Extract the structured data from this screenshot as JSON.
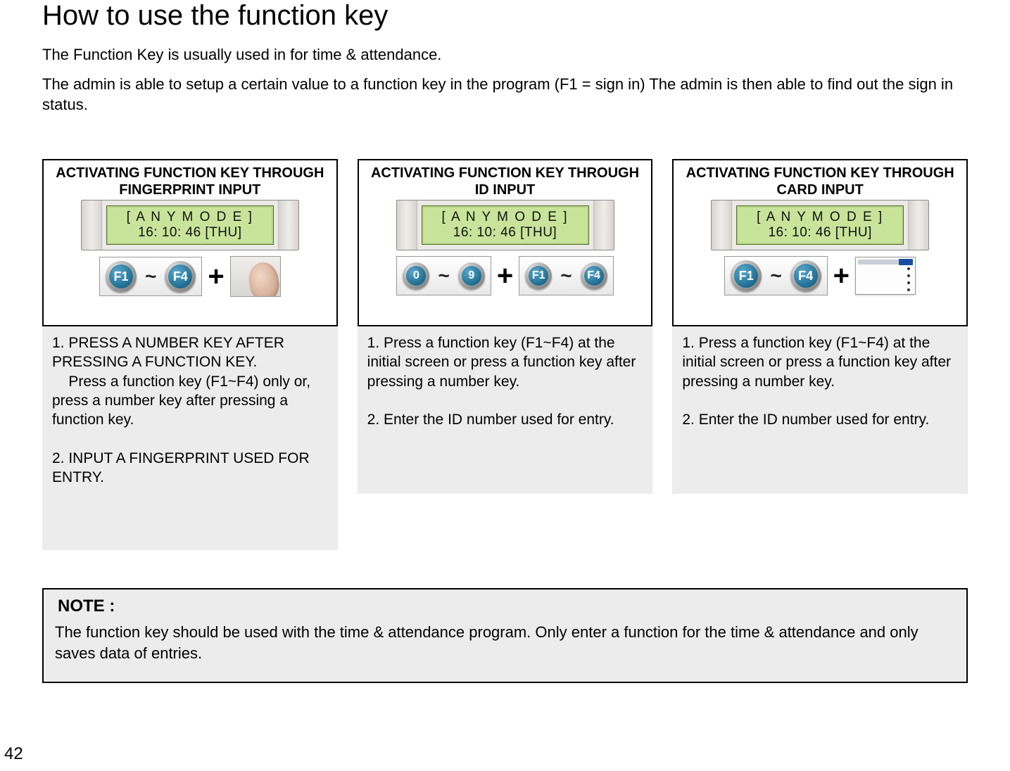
{
  "page_number": "42",
  "title": "How to use the function key",
  "intro1": "The Function Key is usually used in for time & attendance.",
  "intro2": "The admin is able to setup a certain value to a function key in the program (F1 = sign in) The admin is then able to find out the sign in status.",
  "lcd": {
    "line1": "[ A N Y  M O D E ]",
    "line2": "16: 10: 46 [THU]"
  },
  "keys": {
    "f1": "F1",
    "f4": "F4",
    "d0": "0",
    "d9": "9"
  },
  "tilde": "~",
  "plus": "+",
  "columns": [
    {
      "heading": "ACTIVATING FUNCTION KEY THROUGH FINGERPRINT INPUT",
      "steps": "1. PRESS A NUMBER KEY AFTER PRESSING A FUNCTION KEY.\n    Press a function key (F1~F4) only or, press a number key after pressing a function key.\n\n2. INPUT A FINGERPRINT USED FOR ENTRY."
    },
    {
      "heading": "ACTIVATING FUNCTION KEY THROUGH ID INPUT",
      "steps": "1. Press a function key (F1~F4) at the initial screen or press a function key after pressing a number key.\n\n2. Enter the ID number used for entry."
    },
    {
      "heading": "ACTIVATING FUNCTION KEY THROUGH CARD INPUT",
      "steps": "1. Press a function key (F1~F4) at the initial screen or press a function key after pressing a number key.\n\n2. Enter the ID number used for entry."
    }
  ],
  "note": {
    "label": "NOTE :",
    "text": "The function key should be used with the time & attendance program. Only enter a function for the time & attendance and only saves data of entries."
  }
}
